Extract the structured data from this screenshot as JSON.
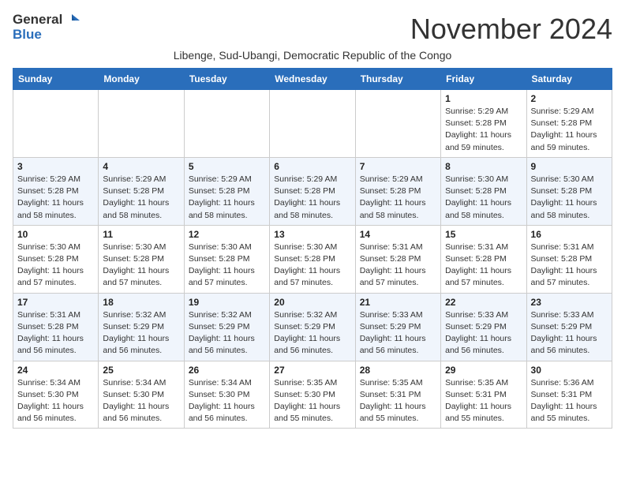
{
  "header": {
    "logo_general": "General",
    "logo_blue": "Blue",
    "month_title": "November 2024",
    "subtitle": "Libenge, Sud-Ubangi, Democratic Republic of the Congo"
  },
  "weekdays": [
    "Sunday",
    "Monday",
    "Tuesday",
    "Wednesday",
    "Thursday",
    "Friday",
    "Saturday"
  ],
  "weeks": [
    [
      {
        "day": "",
        "info": ""
      },
      {
        "day": "",
        "info": ""
      },
      {
        "day": "",
        "info": ""
      },
      {
        "day": "",
        "info": ""
      },
      {
        "day": "",
        "info": ""
      },
      {
        "day": "1",
        "info": "Sunrise: 5:29 AM\nSunset: 5:28 PM\nDaylight: 11 hours and 59 minutes."
      },
      {
        "day": "2",
        "info": "Sunrise: 5:29 AM\nSunset: 5:28 PM\nDaylight: 11 hours and 59 minutes."
      }
    ],
    [
      {
        "day": "3",
        "info": "Sunrise: 5:29 AM\nSunset: 5:28 PM\nDaylight: 11 hours and 58 minutes."
      },
      {
        "day": "4",
        "info": "Sunrise: 5:29 AM\nSunset: 5:28 PM\nDaylight: 11 hours and 58 minutes."
      },
      {
        "day": "5",
        "info": "Sunrise: 5:29 AM\nSunset: 5:28 PM\nDaylight: 11 hours and 58 minutes."
      },
      {
        "day": "6",
        "info": "Sunrise: 5:29 AM\nSunset: 5:28 PM\nDaylight: 11 hours and 58 minutes."
      },
      {
        "day": "7",
        "info": "Sunrise: 5:29 AM\nSunset: 5:28 PM\nDaylight: 11 hours and 58 minutes."
      },
      {
        "day": "8",
        "info": "Sunrise: 5:30 AM\nSunset: 5:28 PM\nDaylight: 11 hours and 58 minutes."
      },
      {
        "day": "9",
        "info": "Sunrise: 5:30 AM\nSunset: 5:28 PM\nDaylight: 11 hours and 58 minutes."
      }
    ],
    [
      {
        "day": "10",
        "info": "Sunrise: 5:30 AM\nSunset: 5:28 PM\nDaylight: 11 hours and 57 minutes."
      },
      {
        "day": "11",
        "info": "Sunrise: 5:30 AM\nSunset: 5:28 PM\nDaylight: 11 hours and 57 minutes."
      },
      {
        "day": "12",
        "info": "Sunrise: 5:30 AM\nSunset: 5:28 PM\nDaylight: 11 hours and 57 minutes."
      },
      {
        "day": "13",
        "info": "Sunrise: 5:30 AM\nSunset: 5:28 PM\nDaylight: 11 hours and 57 minutes."
      },
      {
        "day": "14",
        "info": "Sunrise: 5:31 AM\nSunset: 5:28 PM\nDaylight: 11 hours and 57 minutes."
      },
      {
        "day": "15",
        "info": "Sunrise: 5:31 AM\nSunset: 5:28 PM\nDaylight: 11 hours and 57 minutes."
      },
      {
        "day": "16",
        "info": "Sunrise: 5:31 AM\nSunset: 5:28 PM\nDaylight: 11 hours and 57 minutes."
      }
    ],
    [
      {
        "day": "17",
        "info": "Sunrise: 5:31 AM\nSunset: 5:28 PM\nDaylight: 11 hours and 56 minutes."
      },
      {
        "day": "18",
        "info": "Sunrise: 5:32 AM\nSunset: 5:29 PM\nDaylight: 11 hours and 56 minutes."
      },
      {
        "day": "19",
        "info": "Sunrise: 5:32 AM\nSunset: 5:29 PM\nDaylight: 11 hours and 56 minutes."
      },
      {
        "day": "20",
        "info": "Sunrise: 5:32 AM\nSunset: 5:29 PM\nDaylight: 11 hours and 56 minutes."
      },
      {
        "day": "21",
        "info": "Sunrise: 5:33 AM\nSunset: 5:29 PM\nDaylight: 11 hours and 56 minutes."
      },
      {
        "day": "22",
        "info": "Sunrise: 5:33 AM\nSunset: 5:29 PM\nDaylight: 11 hours and 56 minutes."
      },
      {
        "day": "23",
        "info": "Sunrise: 5:33 AM\nSunset: 5:29 PM\nDaylight: 11 hours and 56 minutes."
      }
    ],
    [
      {
        "day": "24",
        "info": "Sunrise: 5:34 AM\nSunset: 5:30 PM\nDaylight: 11 hours and 56 minutes."
      },
      {
        "day": "25",
        "info": "Sunrise: 5:34 AM\nSunset: 5:30 PM\nDaylight: 11 hours and 56 minutes."
      },
      {
        "day": "26",
        "info": "Sunrise: 5:34 AM\nSunset: 5:30 PM\nDaylight: 11 hours and 56 minutes."
      },
      {
        "day": "27",
        "info": "Sunrise: 5:35 AM\nSunset: 5:30 PM\nDaylight: 11 hours and 55 minutes."
      },
      {
        "day": "28",
        "info": "Sunrise: 5:35 AM\nSunset: 5:31 PM\nDaylight: 11 hours and 55 minutes."
      },
      {
        "day": "29",
        "info": "Sunrise: 5:35 AM\nSunset: 5:31 PM\nDaylight: 11 hours and 55 minutes."
      },
      {
        "day": "30",
        "info": "Sunrise: 5:36 AM\nSunset: 5:31 PM\nDaylight: 11 hours and 55 minutes."
      }
    ]
  ]
}
